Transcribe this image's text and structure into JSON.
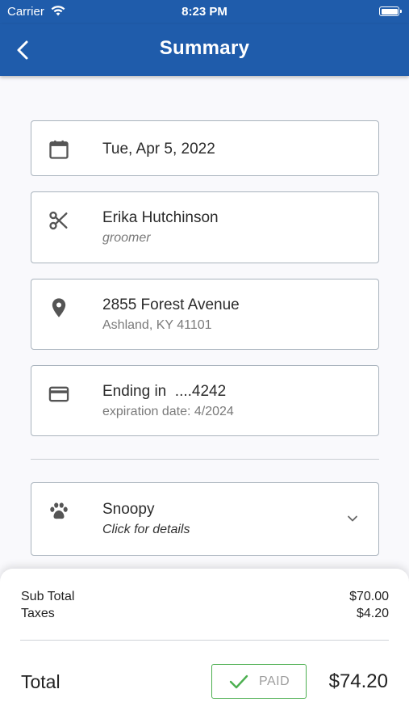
{
  "status_bar": {
    "carrier": "Carrier",
    "time": "8:23 PM"
  },
  "nav": {
    "title": "Summary",
    "back_icon": "chevron-left-icon"
  },
  "appointment": {
    "date": "Tue, Apr 5, 2022",
    "groomer_name": "Erika Hutchinson",
    "groomer_role": "groomer",
    "address_line1": "2855 Forest Avenue",
    "address_line2": "Ashland, KY 41101",
    "card_label": "Ending in  ....4242",
    "card_expiration": "expiration date: 4/2024",
    "pet_name": "Snoopy",
    "pet_hint": "Click for details"
  },
  "icons": {
    "date": "calendar-icon",
    "groomer": "scissors-icon",
    "address": "location-pin-icon",
    "payment": "credit-card-icon",
    "pet": "paw-icon",
    "expand": "chevron-down-icon",
    "paid": "check-icon"
  },
  "totals": {
    "subtotal_label": "Sub Total",
    "subtotal_value": "$70.00",
    "taxes_label": "Taxes",
    "taxes_value": "$4.20",
    "total_label": "Total",
    "paid_label": "PAID",
    "total_value": "$74.20"
  },
  "colors": {
    "primary": "#1f5cab",
    "paid_green": "#4caf50",
    "border": "#a9b3bd"
  }
}
